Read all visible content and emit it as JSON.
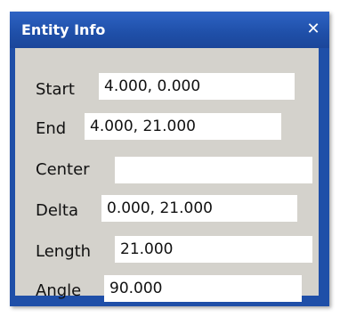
{
  "window": {
    "title": "Entity Info",
    "close_label": "✕"
  },
  "fields": [
    {
      "label": "Start",
      "value": "4.000, 0.000"
    },
    {
      "label": "End",
      "value": "4.000, 21.000"
    },
    {
      "label": "Center",
      "value": ""
    },
    {
      "label": "Delta",
      "value": "0.000, 21.000"
    },
    {
      "label": "Length",
      "value": "21.000"
    },
    {
      "label": "Angle",
      "value": "90.000"
    }
  ],
  "colors": {
    "titlebar": "#1f4fa8",
    "panel": "#d4d2cc",
    "field": "#ffffff"
  },
  "icons": {
    "close": "close-icon"
  }
}
